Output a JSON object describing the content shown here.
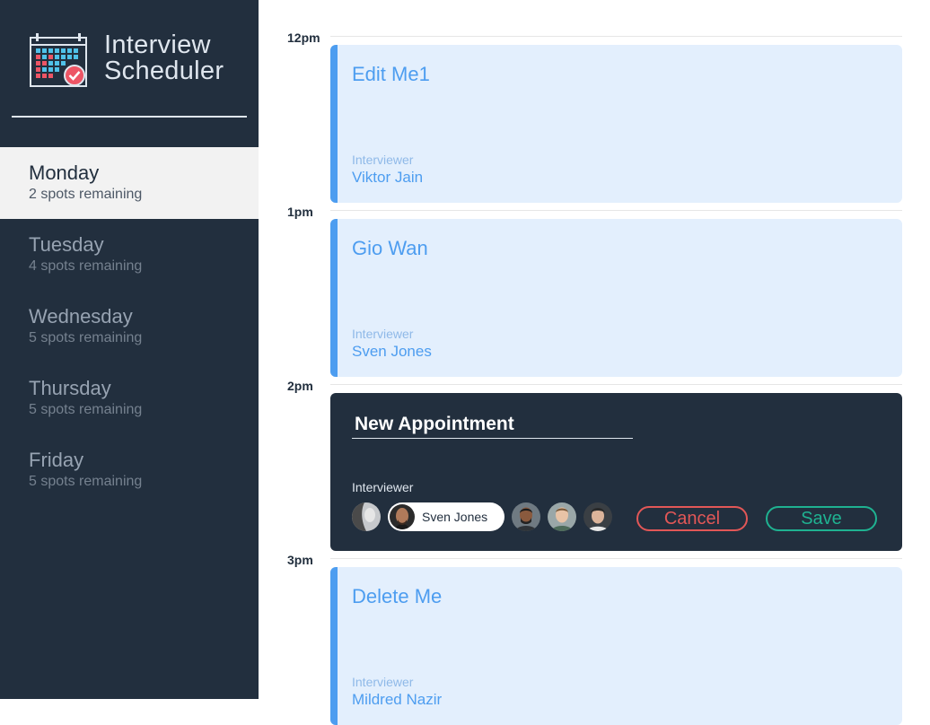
{
  "app": {
    "title_line1": "Interview",
    "title_line2": "Scheduler"
  },
  "days": [
    {
      "name": "Monday",
      "spots": "2 spots remaining",
      "selected": true
    },
    {
      "name": "Tuesday",
      "spots": "4 spots remaining",
      "selected": false
    },
    {
      "name": "Wednesday",
      "spots": "5 spots remaining",
      "selected": false
    },
    {
      "name": "Thursday",
      "spots": "5 spots remaining",
      "selected": false
    },
    {
      "name": "Friday",
      "spots": "5 spots remaining",
      "selected": false
    }
  ],
  "slots": [
    {
      "time": "12pm",
      "student": "Edit Me1",
      "interviewer_label": "Interviewer",
      "interviewer": "Viktor Jain"
    },
    {
      "time": "1pm",
      "student": "Gio Wan",
      "interviewer_label": "Interviewer",
      "interviewer": "Sven Jones"
    },
    {
      "time": "2pm"
    },
    {
      "time": "3pm",
      "student": "Delete Me",
      "interviewer_label": "Interviewer",
      "interviewer": "Mildred Nazir"
    }
  ],
  "form": {
    "name_value": "New Appointment",
    "interviewer_label": "Interviewer",
    "selected_interviewer": "Sven Jones",
    "avatars": [
      "avatar-1",
      "avatar-selected",
      "avatar-3",
      "avatar-4",
      "avatar-5"
    ],
    "cancel_label": "Cancel",
    "save_label": "Save"
  },
  "colors": {
    "sidebar": "#222f3e",
    "accent": "#4d9df0",
    "card": "#e3effd",
    "cancel": "#e25757",
    "save": "#1fb291"
  }
}
